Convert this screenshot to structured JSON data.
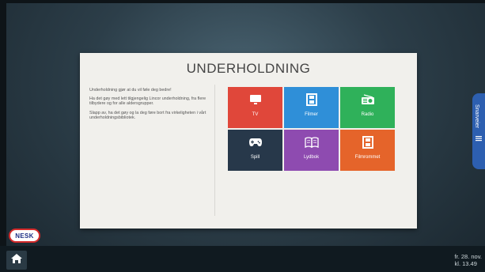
{
  "panel": {
    "title": "UNDERHOLDNING",
    "intro": [
      "Underholdning gjør at du vil føle deg bedre!",
      "Ha det gøy med lett tilgjengelig Lincor underholdning, fra flere tilbydere og for alle aldersgrupper.",
      "Slapp av, ha det gøy og la deg føre bort fra virkeligheten i vårt underholdningsbibliotek."
    ]
  },
  "tiles": [
    {
      "label": "TV",
      "color": "#e0473a",
      "icon": "tv-icon"
    },
    {
      "label": "Filmer",
      "color": "#2f8fd8",
      "icon": "film-icon"
    },
    {
      "label": "Radio",
      "color": "#2fb15a",
      "icon": "radio-icon"
    },
    {
      "label": "Spill",
      "color": "#27384a",
      "icon": "gamepad-icon"
    },
    {
      "label": "Lydbok",
      "color": "#8e4bb0",
      "icon": "book-icon"
    },
    {
      "label": "Filmrommet",
      "color": "#e5642a",
      "icon": "film-icon"
    }
  ],
  "logo": {
    "text": "NESK"
  },
  "side_tab": {
    "label": "Snarveier"
  },
  "datetime": {
    "date": "fr. 28. nov.",
    "time": "kl. 13.49"
  },
  "icons": {
    "home": "home-icon",
    "menu": "menu-icon"
  },
  "colors": {
    "side_tab": "#2d5fb0",
    "logo_border": "#d42a2a",
    "logo_text": "#1e2f86"
  }
}
